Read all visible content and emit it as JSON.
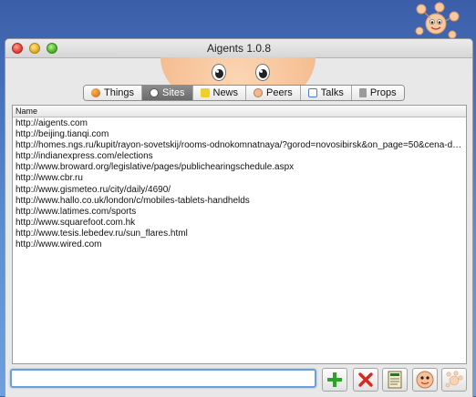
{
  "window": {
    "title": "Aigents 1.0.8"
  },
  "tabs": [
    {
      "label": "Things",
      "icon": "things-icon",
      "color": "#d98b2a"
    },
    {
      "label": "Sites",
      "icon": "sites-icon",
      "color": "#6b6b6b",
      "active": true
    },
    {
      "label": "News",
      "icon": "news-icon",
      "color": "#e8c21b"
    },
    {
      "label": "Peers",
      "icon": "peers-icon",
      "color": "#f2b88f"
    },
    {
      "label": "Talks",
      "icon": "talks-icon",
      "color": "#4a7fd0"
    },
    {
      "label": "Props",
      "icon": "props-icon",
      "color": "#8a8a8a"
    }
  ],
  "table": {
    "header": "Name",
    "rows": [
      "http://aigents.com",
      "http://beijing.tianqi.com",
      "http://homes.ngs.ru/kupit/rayon-sovetskij/rooms-odnokomnatnaya/?gorod=novosibirsk&on_page=50&cena-d…",
      "http://indianexpress.com/elections",
      "http://www.broward.org/legislative/pages/publichearingschedule.aspx",
      "http://www.cbr.ru",
      "http://www.gismeteo.ru/city/daily/4690/",
      "http://www.hallo.co.uk/london/c/mobiles-tablets-handhelds",
      "http://www.latimes.com/sports",
      "http://www.squarefoot.com.hk",
      "http://www.tesis.lebedev.ru/sun_flares.html",
      "http://www.wired.com"
    ]
  },
  "input": {
    "value": "",
    "placeholder": ""
  },
  "buttons": [
    {
      "name": "add-button",
      "icon": "plus-icon"
    },
    {
      "name": "delete-button",
      "icon": "x-icon"
    },
    {
      "name": "spellbook-button",
      "icon": "book-icon"
    },
    {
      "name": "face-button",
      "icon": "face-icon"
    },
    {
      "name": "logo-button",
      "icon": "aigents-logo-icon"
    }
  ],
  "colors": {
    "accent": "#6b9fdc",
    "add": "#2aa52a",
    "delete": "#d42a1f"
  }
}
